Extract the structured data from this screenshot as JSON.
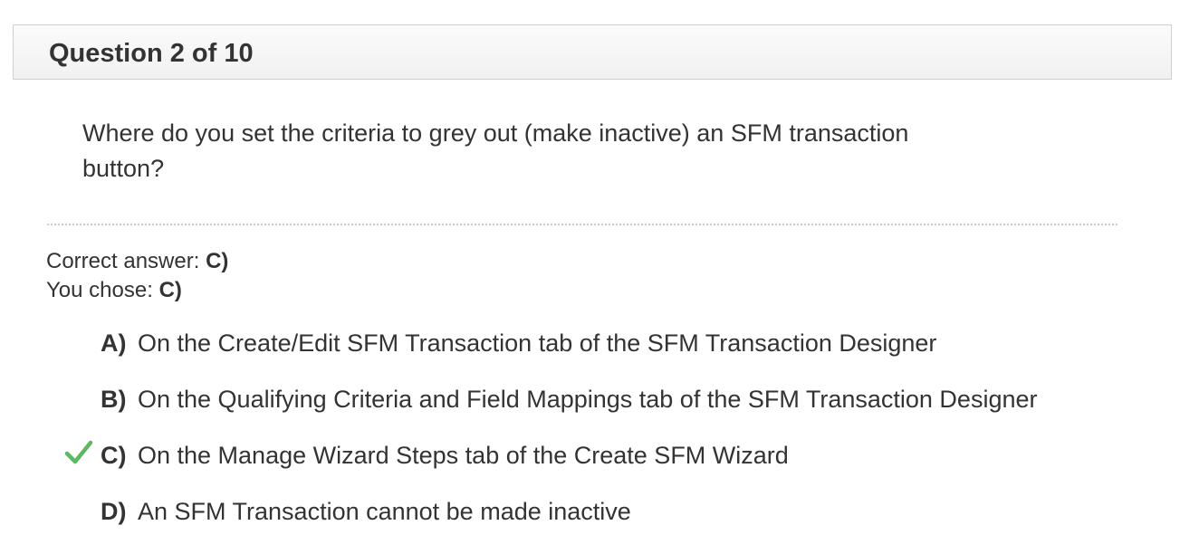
{
  "header": {
    "title": "Question 2 of 10"
  },
  "question": {
    "text": "Where do you set the criteria to grey out (make inactive) an SFM transaction button?"
  },
  "result": {
    "correct_label": "Correct answer:",
    "correct_value": "C)",
    "chosen_label": "You chose:",
    "chosen_value": "C)"
  },
  "options": [
    {
      "letter": "A)",
      "text": "On the Create/Edit SFM Transaction tab of the SFM Transaction Designer",
      "marked_correct": false
    },
    {
      "letter": "B)",
      "text": "On the Qualifying Criteria and Field Mappings tab of the SFM Transaction Designer",
      "marked_correct": false
    },
    {
      "letter": "C)",
      "text": "On the Manage Wizard Steps tab of the Create SFM Wizard",
      "marked_correct": true
    },
    {
      "letter": "D)",
      "text": "An SFM Transaction cannot be made inactive",
      "marked_correct": false
    }
  ],
  "icons": {
    "correct_marker": "checkmark-icon"
  },
  "colors": {
    "check": "#5fb760",
    "text": "#333333",
    "header_border": "#cfcfcf"
  }
}
